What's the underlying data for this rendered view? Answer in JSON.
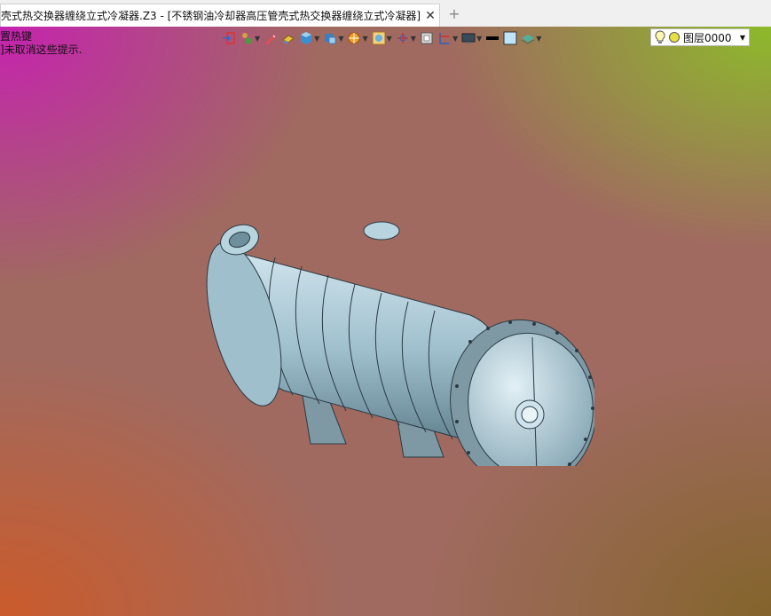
{
  "tab": {
    "title": "壳式热交换器缠绕立式冷凝器.Z3 - [不锈钢油冷却器高压管壳式热交换器缠绕立式冷凝器]",
    "close_glyph": "✕",
    "add_glyph": "+"
  },
  "hints": {
    "line1": "置热键",
    "line2": "]未取消这些提示."
  },
  "toolbar": {
    "items": [
      "exit-icon",
      "layer-tool-icon",
      "sketch-pencil-icon",
      "eraser-icon",
      "solid-cube-icon",
      "view-cube-icon",
      "appearance-icon",
      "zoom-fit-icon",
      "axis-icon",
      "frame-icon",
      "section-icon",
      "display-icon",
      "line-black-icon",
      "color-swatch-icon",
      "layer-stack-icon"
    ]
  },
  "layer": {
    "label": "图层0000",
    "bulb": "lightbulb-icon",
    "dot": "yellow-circle-icon"
  },
  "colors": {
    "model_fill": "#a8c8d6",
    "model_stroke": "#2a3a44"
  }
}
